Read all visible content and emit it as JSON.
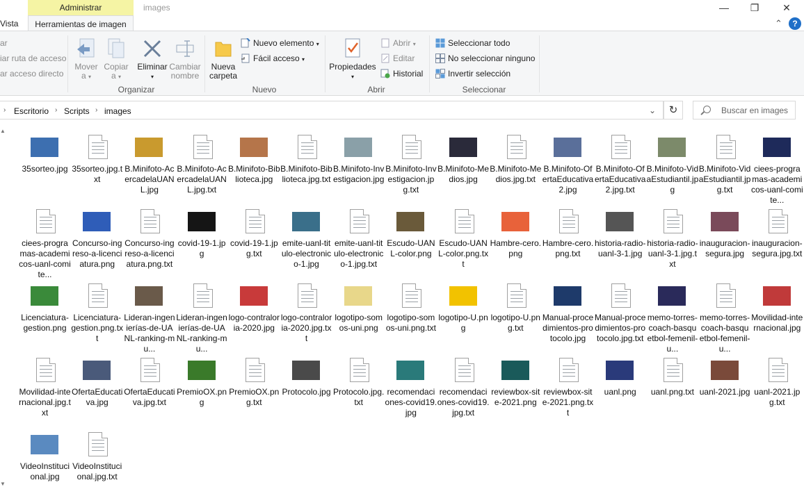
{
  "window": {
    "title": "images",
    "context_tab_header": "Administrar"
  },
  "tabs": {
    "vista": "Vista",
    "herramientas": "Herramientas de imagen"
  },
  "ribbon": {
    "organizar": {
      "label": "Organizar",
      "left_items": [
        "ar",
        "iar ruta de acceso",
        "ar acceso directo"
      ],
      "move": {
        "line1": "Mover",
        "line2": "a"
      },
      "copy": {
        "line1": "Copiar",
        "line2": "a"
      },
      "delete": "Eliminar",
      "rename": {
        "line1": "Cambiar",
        "line2": "nombre"
      }
    },
    "nuevo": {
      "label": "Nuevo",
      "new_folder": {
        "line1": "Nueva",
        "line2": "carpeta"
      },
      "new_item": "Nuevo elemento",
      "easy_access": "Fácil acceso"
    },
    "abrir": {
      "label": "Abrir",
      "properties": "Propiedades",
      "open": "Abrir",
      "edit": "Editar",
      "history": "Historial"
    },
    "seleccionar": {
      "label": "Seleccionar",
      "select_all": "Seleccionar todo",
      "select_none": "No seleccionar ninguno",
      "invert": "Invertir selección"
    }
  },
  "address": {
    "crumbs": [
      "Escritorio",
      "Scripts",
      "images"
    ]
  },
  "search": {
    "placeholder": "Buscar en images"
  },
  "files": [
    {
      "name": "35sorteo.jpg",
      "kind": "image",
      "color": "#3d6fb0"
    },
    {
      "name": "35sorteo.jpg.txt",
      "kind": "text"
    },
    {
      "name": "B.Minifoto-AcercadelaUANL.jpg",
      "kind": "image",
      "color": "#c99a2e"
    },
    {
      "name": "B.Minifoto-AcercadelaUANL.jpg.txt",
      "kind": "text"
    },
    {
      "name": "B.Minifoto-Biblioteca.jpg",
      "kind": "image",
      "color": "#b5754a"
    },
    {
      "name": "B.Minifoto-Biblioteca.jpg.txt",
      "kind": "text"
    },
    {
      "name": "B.Minifoto-Investigacion.jpg",
      "kind": "image",
      "color": "#8aa0a8"
    },
    {
      "name": "B.Minifoto-Investigacion.jpg.txt",
      "kind": "text"
    },
    {
      "name": "B.Minifoto-Medios.jpg",
      "kind": "image",
      "color": "#2a2a3a"
    },
    {
      "name": "B.Minifoto-Medios.jpg.txt",
      "kind": "text"
    },
    {
      "name": "B.Minifoto-OfertaEducativa2.jpg",
      "kind": "image",
      "color": "#5a6f9a"
    },
    {
      "name": "B.Minifoto-OfertaEducativa2.jpg.txt",
      "kind": "text"
    },
    {
      "name": "B.Minifoto-VidaEstudiantil.jpg",
      "kind": "image",
      "color": "#7c8a6a"
    },
    {
      "name": "B.Minifoto-VidaEstudiantil.jpg.txt",
      "kind": "text"
    },
    {
      "name": "ciees-programas-academicos-uanl-comite...",
      "kind": "image",
      "color": "#1e2a5a"
    },
    {
      "name": "ciees-programas-academicos-uanl-comite...",
      "kind": "text"
    },
    {
      "name": "Concurso-ingreso-a-licenciatura.png",
      "kind": "image",
      "color": "#2f5db8"
    },
    {
      "name": "Concurso-ingreso-a-licenciatura.png.txt",
      "kind": "text"
    },
    {
      "name": "covid-19-1.jpg",
      "kind": "image",
      "color": "#151515"
    },
    {
      "name": "covid-19-1.jpg.txt",
      "kind": "text"
    },
    {
      "name": "emite-uanl-titulo-electronico-1.jpg",
      "kind": "image",
      "color": "#3a6f8a"
    },
    {
      "name": "emite-uanl-titulo-electronico-1.jpg.txt",
      "kind": "text"
    },
    {
      "name": "Escudo-UANL-color.png",
      "kind": "image",
      "color": "#6a5a3a"
    },
    {
      "name": "Escudo-UANL-color.png.txt",
      "kind": "text"
    },
    {
      "name": "Hambre-cero.png",
      "kind": "image",
      "color": "#e8623a"
    },
    {
      "name": "Hambre-cero.png.txt",
      "kind": "text"
    },
    {
      "name": "historia-radio-uanl-3-1.jpg",
      "kind": "image",
      "color": "#555555"
    },
    {
      "name": "historia-radio-uanl-3-1.jpg.txt",
      "kind": "text"
    },
    {
      "name": "inauguracion-segura.jpg",
      "kind": "image",
      "color": "#7a4a5a"
    },
    {
      "name": "inauguracion-segura.jpg.txt",
      "kind": "text"
    },
    {
      "name": "Licenciatura-gestion.png",
      "kind": "image",
      "color": "#3a8a3a"
    },
    {
      "name": "Licenciatura-gestion.png.txt",
      "kind": "text"
    },
    {
      "name": "Lideran-ingenierías-de-UANL-ranking-mu...",
      "kind": "image",
      "color": "#6a5a4a"
    },
    {
      "name": "Lideran-ingenierías-de-UANL-ranking-mu...",
      "kind": "text"
    },
    {
      "name": "logo-contraloria-2020.jpg",
      "kind": "image",
      "color": "#c83a3a"
    },
    {
      "name": "logo-contraloria-2020.jpg.txt",
      "kind": "text"
    },
    {
      "name": "logotipo-somos-uni.png",
      "kind": "image",
      "color": "#e8d78a"
    },
    {
      "name": "logotipo-somos-uni.png.txt",
      "kind": "text"
    },
    {
      "name": "logotipo-U.png",
      "kind": "image",
      "color": "#f2c200"
    },
    {
      "name": "logotipo-U.png.txt",
      "kind": "text"
    },
    {
      "name": "Manual-procedimientos-protocolo.jpg",
      "kind": "image",
      "color": "#1e3a6a"
    },
    {
      "name": "Manual-procedimientos-protocolo.jpg.txt",
      "kind": "text"
    },
    {
      "name": "memo-torres-coach-basquetbol-femenil-u...",
      "kind": "image",
      "color": "#2a2a5a"
    },
    {
      "name": "memo-torres-coach-basquetbol-femenil-u...",
      "kind": "text"
    },
    {
      "name": "Movilidad-internacional.jpg",
      "kind": "image",
      "color": "#c03a3a"
    },
    {
      "name": "Movilidad-internacional.jpg.txt",
      "kind": "text"
    },
    {
      "name": "OfertaEducativa.jpg",
      "kind": "image",
      "color": "#4a5a7a"
    },
    {
      "name": "OfertaEducativa.jpg.txt",
      "kind": "text"
    },
    {
      "name": "PremioOX.png",
      "kind": "image",
      "color": "#3a7a2a"
    },
    {
      "name": "PremioOX.png.txt",
      "kind": "text"
    },
    {
      "name": "Protocolo.jpg",
      "kind": "image",
      "color": "#4a4a4a"
    },
    {
      "name": "Protocolo.jpg.txt",
      "kind": "text"
    },
    {
      "name": "recomendaciones-covid19.jpg",
      "kind": "image",
      "color": "#2a7a7a"
    },
    {
      "name": "recomendaciones-covid19.jpg.txt",
      "kind": "text"
    },
    {
      "name": "reviewbox-site-2021.png",
      "kind": "image",
      "color": "#1a5a5a"
    },
    {
      "name": "reviewbox-site-2021.png.txt",
      "kind": "text"
    },
    {
      "name": "uanl.png",
      "kind": "image",
      "color": "#2a3a7a"
    },
    {
      "name": "uanl.png.txt",
      "kind": "text"
    },
    {
      "name": "uanl-2021.jpg",
      "kind": "image",
      "color": "#7a4a3a"
    },
    {
      "name": "uanl-2021.jpg.txt",
      "kind": "text"
    },
    {
      "name": "VideoInstitucional.jpg",
      "kind": "image",
      "color": "#5a8ac0"
    },
    {
      "name": "VideoInstitucional.jpg.txt",
      "kind": "text"
    }
  ]
}
